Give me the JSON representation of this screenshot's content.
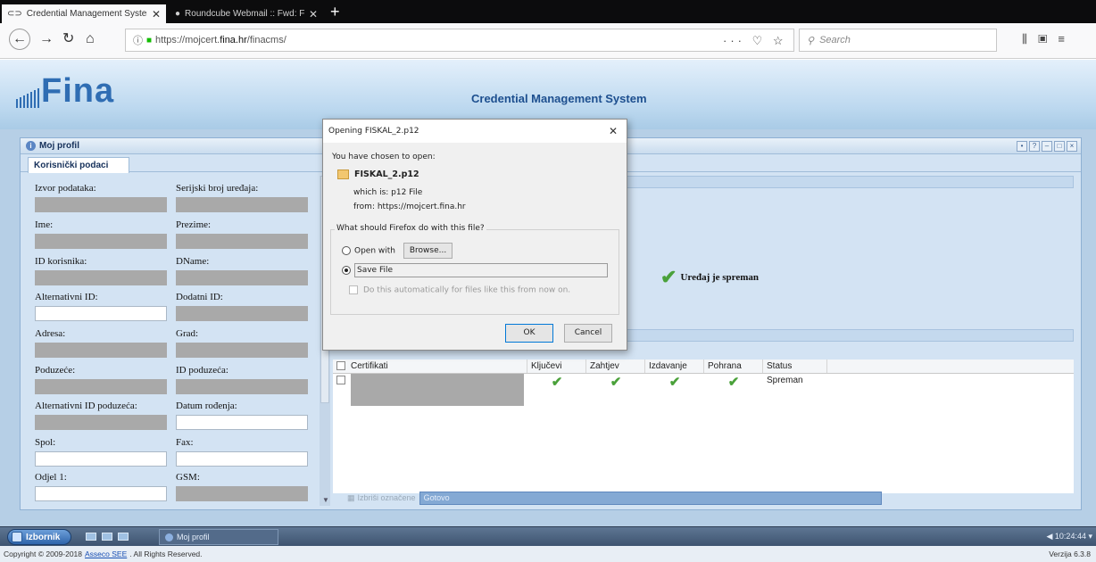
{
  "browser": {
    "tabs": [
      {
        "title": "Credential Management Syster",
        "active": true
      },
      {
        "title": "Roundcube Webmail :: Fwd: Fw",
        "active": false
      }
    ],
    "url": {
      "prefix": "https://mojcert.",
      "domain": "fina.hr",
      "path": "/finacms/"
    },
    "search_placeholder": "Search"
  },
  "app": {
    "logo": "Fina",
    "title": "Credential Management System"
  },
  "profile_window": {
    "title": "Moj profil",
    "tab": "Korisnički podaci",
    "fields": [
      {
        "label": "Izvor podataka:",
        "filled": true
      },
      {
        "label": "Serijski broj uređaja:",
        "filled": true
      },
      {
        "label": "Ime:",
        "filled": true
      },
      {
        "label": "Prezime:",
        "filled": true
      },
      {
        "label": "ID korisnika:",
        "filled": true
      },
      {
        "label": "DName:",
        "filled": true
      },
      {
        "label": "Alternativni ID:",
        "filled": false
      },
      {
        "label": "Dodatni ID:",
        "filled": true
      },
      {
        "label": "Adresa:",
        "filled": true
      },
      {
        "label": "Grad:",
        "filled": true
      },
      {
        "label": "Poduzeće:",
        "filled": true
      },
      {
        "label": "ID poduzeća:",
        "filled": true
      },
      {
        "label": "Alternativni ID poduzeća:",
        "filled": true
      },
      {
        "label": "Datum rođenja:",
        "filled": false
      },
      {
        "label": "Spol:",
        "filled": false
      },
      {
        "label": "Fax:",
        "filled": false
      },
      {
        "label": "Odjel 1:",
        "filled": false
      },
      {
        "label": "GSM:",
        "filled": true
      }
    ],
    "device_status": "Uređaj je spreman",
    "grid": {
      "columns": [
        "Certifikati",
        "Ključevi",
        "Zahtjev",
        "Izdavanje",
        "Pohrana",
        "Status"
      ],
      "row": {
        "kljucevi": "✔",
        "zahtjev": "✔",
        "izdavanje": "✔",
        "pohrana": "✔",
        "status": "Spreman"
      }
    },
    "delete_label": "Izbriši označene",
    "status_text": "Gotovo"
  },
  "dialog": {
    "title": "Opening FISKAL_2.p12",
    "intro": "You have chosen to open:",
    "filename": "FISKAL_2.p12",
    "which_is": "which is: p12 File",
    "from": "from: https://mojcert.fina.hr",
    "question": "What should Firefox do with this file?",
    "open_with": "Open with",
    "browse": "Browse...",
    "save_file": "Save File",
    "auto": "Do this automatically for files like this from now on.",
    "ok": "OK",
    "cancel": "Cancel"
  },
  "taskbar": {
    "start": "Izbornik",
    "task": "Moj profil",
    "clock": "10:24:44"
  },
  "footer": {
    "copyright_prefix": "Copyright © 2009-2018",
    "company": "Asseco SEE",
    "copyright_suffix": ". All Rights Reserved.",
    "version": "Verzija 6.3.8"
  }
}
